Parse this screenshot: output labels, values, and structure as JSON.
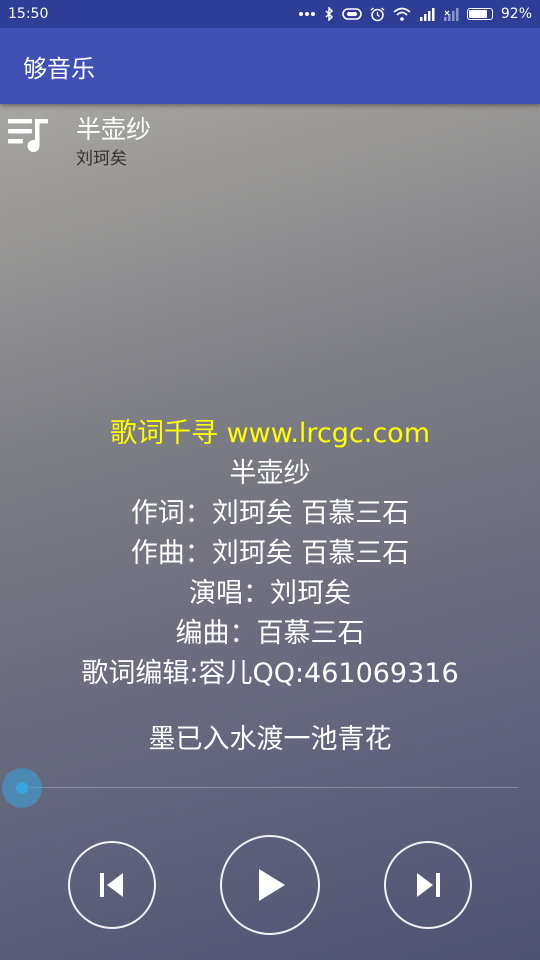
{
  "status_bar": {
    "time": "15:50",
    "battery_percent": "92%",
    "battery_level": 0.92,
    "icons": [
      "more-dots-icon",
      "bluetooth-icon",
      "vibrate-icon",
      "alarm-icon",
      "wifi-icon",
      "signal-icon",
      "signal-no-sim-icon",
      "battery-icon"
    ]
  },
  "app_bar": {
    "title": "够音乐"
  },
  "now_playing": {
    "title": "半壶纱",
    "artist": "刘珂矣"
  },
  "lyrics": {
    "lines": [
      "歌词千寻 www.lrcgc.com",
      "半壶纱",
      "作词：刘珂矣 百慕三石",
      "作曲：刘珂矣 百慕三石",
      "演唱：刘珂矣",
      "编曲：百慕三石",
      "歌词编辑:容儿QQ:461069316"
    ],
    "current_line": "墨已入水渡一池青花",
    "highlight_color": "#ffff00"
  },
  "player": {
    "progress": 0.0,
    "controls": [
      "previous-icon",
      "play-icon",
      "next-icon"
    ]
  },
  "colors": {
    "status_bar": "#2e3e96",
    "app_bar": "#3f51b5",
    "accent": "#39a5e0"
  }
}
